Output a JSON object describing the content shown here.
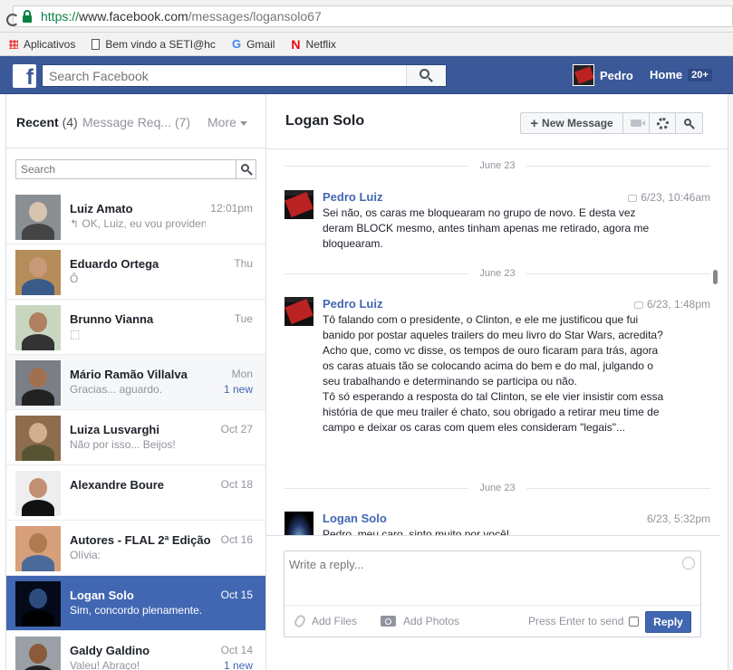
{
  "browser": {
    "url_protocol": "https://",
    "url_host": "www.facebook.com",
    "url_path": "/messages/logansolo67",
    "bookmarks": [
      {
        "label": "Aplicativos",
        "icon": "apps-icon"
      },
      {
        "label": "Bem vindo a SETI@hc",
        "icon": "document-icon"
      },
      {
        "label": "Gmail",
        "icon": "google-icon"
      },
      {
        "label": "Netflix",
        "icon": "netflix-icon"
      }
    ]
  },
  "fbbar": {
    "logo": "f",
    "search_placeholder": "Search Facebook",
    "user_name": "Pedro",
    "home_label": "Home",
    "home_badge": "20+"
  },
  "inbox": {
    "tab_recent": "Recent",
    "tab_recent_count": "(4)",
    "tab_requests": "Message Req... (7)",
    "tab_more": "More",
    "search_placeholder": "Search",
    "conversations": [
      {
        "name": "Luiz Amato",
        "snippet": "↰ OK, Luiz, eu vou providen...",
        "date": "12:01pm",
        "new": "",
        "state": "read"
      },
      {
        "name": "Eduardo Ortega",
        "snippet": "Ô",
        "date": "Thu",
        "new": "",
        "state": "read"
      },
      {
        "name": "Brunno Vianna",
        "snippet": "⬚",
        "date": "Tue",
        "new": "",
        "state": "read"
      },
      {
        "name": "Mário Ramão Villalva",
        "snippet": "Gracias... aguardo.",
        "date": "Mon",
        "new": "1 new",
        "state": "unread"
      },
      {
        "name": "Luiza Lusvarghi",
        "snippet": "Não por isso... Beijos!",
        "date": "Oct 27",
        "new": "",
        "state": "read"
      },
      {
        "name": "Alexandre Boure",
        "snippet": "",
        "date": "Oct 18",
        "new": "",
        "state": "read"
      },
      {
        "name": "Autores - FLAL 2ª Edição",
        "snippet": "Olívia:",
        "date": "Oct 16",
        "new": "",
        "state": "read"
      },
      {
        "name": "Logan Solo",
        "snippet": "Sim, concordo plenamente.",
        "date": "Oct 15",
        "new": "",
        "state": "active"
      },
      {
        "name": "Galdy Galdino",
        "snippet": "Valeu! Abraço!",
        "date": "Oct 14",
        "new": "1 new",
        "state": "read"
      }
    ]
  },
  "thread": {
    "title": "Logan Solo",
    "new_message_label": "New Message",
    "dividers": [
      "June 23",
      "June 23",
      "June 23"
    ],
    "messages": [
      {
        "from": "Pedro Luiz",
        "time": "6/23, 10:46am",
        "body": "Sei não, os caras me bloquearam no grupo de novo. E desta vez deram BLOCK mesmo, antes tinham apenas me retirado, agora me bloquearam."
      },
      {
        "from": "Pedro Luiz",
        "time": "6/23, 1:48pm",
        "body": "Tô falando com o presidente, o Clinton, e ele me justificou que fui banido por postar aqueles trailers do meu livro do Star Wars, acredita?\nAcho que, como vc disse, os tempos de ouro ficaram para trás, agora os caras atuais tão se colocando acima do bem e do mal, julgando o seu trabalhando e determinando se participa ou não.\nTô só esperando a resposta do tal Clinton, se ele vier insistir com essa história de que meu trailer é chato, sou obrigado a retirar meu time de campo e deixar os caras com quem eles consideram \"legais\"..."
      },
      {
        "from": "Logan Solo",
        "time": "6/23, 5:32pm",
        "body": "Pedro, meu caro, sinto muito por você!"
      }
    ]
  },
  "composer": {
    "placeholder": "Write a reply...",
    "add_files": "Add Files",
    "add_photos": "Add Photos",
    "press_enter": "Press Enter to send",
    "reply_label": "Reply"
  },
  "colors": {
    "fb_blue": "#3b5998",
    "active_row": "#4267b2",
    "link": "#4267b2"
  }
}
